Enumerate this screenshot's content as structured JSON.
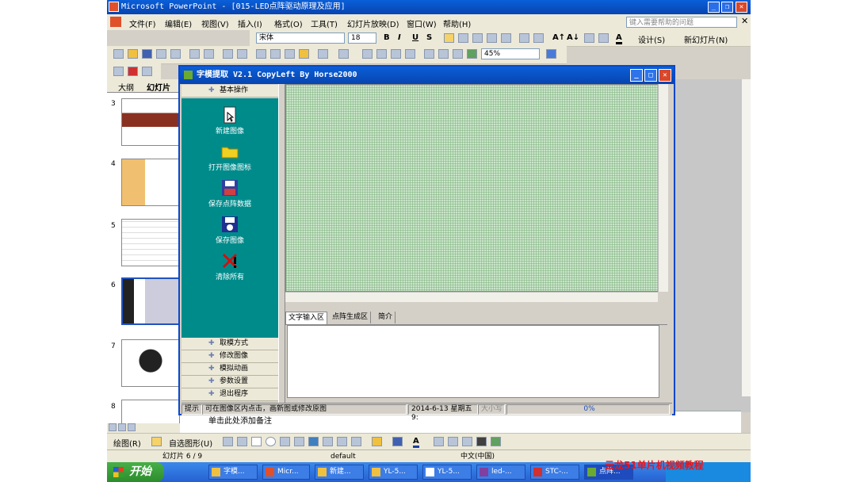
{
  "powerpoint": {
    "title": "Microsoft PowerPoint - [015-LED点阵驱动原理及应用]",
    "menu": [
      "文件(F)",
      "编辑(E)",
      "视图(V)",
      "插入(I)",
      "格式(O)",
      "工具(T)",
      "幻灯片放映(D)",
      "窗口(W)",
      "帮助(H)"
    ],
    "help_placeholder": "键入需要帮助的问题",
    "font_name": "宋体",
    "font_size": "18",
    "zoom": "45%",
    "design_label": "设计(S)",
    "new_slide_label": "新幻灯片(N)",
    "pane_tabs": [
      "大纲",
      "幻灯片"
    ],
    "slide_numbers": [
      "3",
      "4",
      "5",
      "6",
      "7",
      "8"
    ],
    "notes_text": "单击此处添加备注",
    "draw_label": "绘图(R)",
    "autoshape_label": "自选图形(U)",
    "status_slide": "幻灯片 6 / 9",
    "status_design": "default",
    "status_lang": "中文(中国)"
  },
  "dialog": {
    "title": "字模提取 V2.1  CopyLeft By Horse2000",
    "top_section": "基本操作",
    "actions": [
      "新建图像",
      "打开图像图标",
      "保存点阵数据",
      "保存图像",
      "清除所有"
    ],
    "sections": [
      "取模方式",
      "修改图像",
      "模拟动画",
      "参数设置",
      "退出程序"
    ],
    "tabs": [
      "文字输入区",
      "点阵生成区",
      "简介"
    ],
    "status_hint_label": "提示",
    "status_hint": "可在图像区内点击，画新图或修改原图",
    "status_date": "2014-6-13 星期五 9:",
    "status_caps": "大小写",
    "status_progress": "0%"
  },
  "taskbar": {
    "start_label": "开始",
    "tasks": [
      "字模...",
      "Micr...",
      "新建...",
      "YL-5...",
      "YL-5...",
      "led-...",
      "STC-...",
      "点阵..."
    ]
  },
  "watermark": "云龙51单片机视频教程",
  "colors": {
    "title_blue": "#0a5fd8",
    "panel_teal": "#008b8b",
    "grid_green": "#c9e5c9",
    "watermark_red": "#e8141e"
  }
}
